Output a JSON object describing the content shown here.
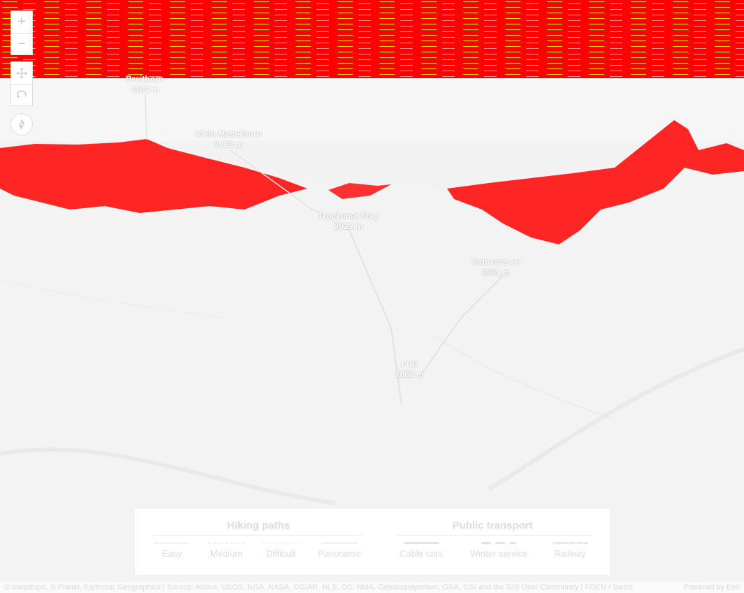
{
  "colors": {
    "sky": "#ff0000",
    "sky_streak": "#ffe100",
    "rock": "#ff0000",
    "terrain": "#f3f3f3",
    "label": "#ffffff",
    "legend_text": "#dcdcdc"
  },
  "controls": {
    "zoom_in": "+",
    "zoom_out": "−",
    "pan_icon": "move-icon",
    "rotate_icon": "rotate-icon",
    "compass_icon": "compass-icon"
  },
  "places": [
    {
      "name": "Breithorn",
      "elevation": "4164 m"
    },
    {
      "name": "Klein Matterhorn",
      "elevation": "3883 m"
    },
    {
      "name": "Trockener Steg",
      "elevation": "2929 m"
    },
    {
      "name": "Schwarzsee",
      "elevation": "2581 m"
    },
    {
      "name": "Furi",
      "elevation": "1862 m"
    }
  ],
  "legend": {
    "hiking": {
      "title": "Hiking paths",
      "items": [
        {
          "label": "Easy",
          "style": "solid-thin"
        },
        {
          "label": "Medium",
          "style": "dashed"
        },
        {
          "label": "Difficult",
          "style": "dotted"
        },
        {
          "label": "Panoramic",
          "style": "solid"
        }
      ]
    },
    "transport": {
      "title": "Public transport",
      "items": [
        {
          "label": "Cable cars",
          "style": "solid-thick"
        },
        {
          "label": "Winter service",
          "style": "dash-long"
        },
        {
          "label": "Railway",
          "style": "rail"
        }
      ]
    }
  },
  "attribution": {
    "text": "© swisstopo, © Planet, Earthstar Geographics | Source: Airbus, USGS, NGA, NASA, CGIAR, NLS, OS, NMA, Geodatastyrelsen, GSA, GSI and the GIS User Community | FOEN / Swiss",
    "powered": "Powered by Esri"
  }
}
